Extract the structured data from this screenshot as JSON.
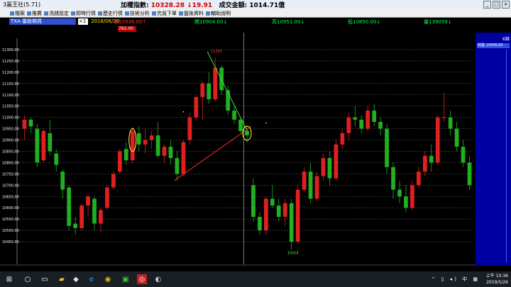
{
  "titlebar": {
    "app_name": "3贏王社(5.71)",
    "index_label": "加權指數: ",
    "index_value": "10328.28",
    "index_change": "↓19.91",
    "turnover_label": "成交金額: ",
    "turnover_value": "1014.71億"
  },
  "menu": {
    "items": [
      "檔案",
      "推薦",
      "洗錢設定",
      "即時行情",
      "歷史行情",
      "技術分析",
      "究竟下單",
      "盤後資料",
      "輔助說明"
    ]
  },
  "info": {
    "symbol": "TXA 臺股期貨",
    "multiplier": "×1",
    "date": "2018/06/20",
    "close": "收10936.00↑",
    "open": "開10904.00↓",
    "high": "高10951.00↓",
    "low": "低10850.00↓",
    "volume": "量139059↓",
    "current_box": "762.00"
  },
  "right_panel": {
    "k_label": "K線",
    "legend": "收盤 10936.00"
  },
  "chart_data": {
    "type": "candlestick",
    "y_ticks": [
      11300,
      11250,
      11200,
      11150,
      11100,
      11050,
      11000,
      10950,
      10900,
      10850,
      10800,
      10750,
      10700,
      10650,
      10600,
      10550,
      10500,
      10450
    ],
    "x_labels": [
      {
        "label": "2018",
        "i": 0
      },
      {
        "label": "4",
        "i": 2
      },
      {
        "label": "5",
        "i": 9
      },
      {
        "label": "6",
        "i": 24
      },
      {
        "label": "7",
        "i": 36
      },
      {
        "label": "8",
        "i": 50
      },
      {
        "label": "9",
        "i": 64
      }
    ],
    "annotation_high": "11263",
    "annotation_low": "10414",
    "candles": [
      [
        10950,
        11010,
        10900,
        10990
      ],
      [
        10990,
        11000,
        10930,
        10960
      ],
      [
        10950,
        10970,
        10780,
        10800
      ],
      [
        10810,
        10950,
        10800,
        10940
      ],
      [
        10930,
        10990,
        10830,
        10850
      ],
      [
        10840,
        10860,
        10760,
        10790
      ],
      [
        10760,
        10770,
        10640,
        10680
      ],
      [
        10690,
        10700,
        10500,
        10520
      ],
      [
        10530,
        10560,
        10480,
        10510
      ],
      [
        10510,
        10620,
        10500,
        10610
      ],
      [
        10610,
        10660,
        10560,
        10650
      ],
      [
        10640,
        10650,
        10500,
        10530
      ],
      [
        10530,
        10600,
        10490,
        10590
      ],
      [
        10600,
        10700,
        10590,
        10690
      ],
      [
        10690,
        10760,
        10680,
        10750
      ],
      [
        10760,
        10860,
        10750,
        10850
      ],
      [
        10860,
        10890,
        10790,
        10810
      ],
      [
        10810,
        10960,
        10800,
        10940
      ],
      [
        10930,
        10960,
        10850,
        10880
      ],
      [
        10880,
        10950,
        10840,
        10900
      ],
      [
        10900,
        10940,
        10860,
        10920
      ],
      [
        10920,
        10980,
        10820,
        10830
      ],
      [
        10830,
        10880,
        10800,
        10870
      ],
      [
        10870,
        10900,
        10790,
        10820
      ],
      [
        10820,
        10850,
        10720,
        10750
      ],
      [
        10750,
        10900,
        10740,
        10890
      ],
      [
        10900,
        11020,
        10880,
        11000
      ],
      [
        11000,
        11100,
        10990,
        11090
      ],
      [
        11090,
        11160,
        10990,
        11150
      ],
      [
        11150,
        11200,
        11060,
        11080
      ],
      [
        11080,
        11263,
        11070,
        11220
      ],
      [
        11220,
        11230,
        11100,
        11120
      ],
      [
        11120,
        11140,
        11010,
        11030
      ],
      [
        11030,
        11050,
        10970,
        10990
      ],
      [
        10990,
        11000,
        10930,
        10940
      ],
      [
        10940,
        10960,
        10890,
        10920
      ],
      [
        10700,
        10730,
        10540,
        10560
      ],
      [
        10560,
        10580,
        10480,
        10500
      ],
      [
        10500,
        10650,
        10480,
        10640
      ],
      [
        10640,
        10700,
        10600,
        10610
      ],
      [
        10610,
        10640,
        10540,
        10560
      ],
      [
        10560,
        10640,
        10520,
        10620
      ],
      [
        10620,
        10640,
        10414,
        10450
      ],
      [
        10450,
        10700,
        10440,
        10680
      ],
      [
        10680,
        10780,
        10670,
        10760
      ],
      [
        10760,
        10800,
        10620,
        10640
      ],
      [
        10640,
        10760,
        10630,
        10740
      ],
      [
        10740,
        10840,
        10720,
        10820
      ],
      [
        10820,
        10850,
        10700,
        10730
      ],
      [
        10730,
        10900,
        10720,
        10880
      ],
      [
        10880,
        10950,
        10860,
        10930
      ],
      [
        10930,
        11020,
        10900,
        11000
      ],
      [
        11000,
        11050,
        10960,
        10990
      ],
      [
        10990,
        11010,
        10930,
        10950
      ],
      [
        10950,
        11050,
        10940,
        11030
      ],
      [
        11030,
        11060,
        10960,
        10980
      ],
      [
        10980,
        11000,
        10920,
        10950
      ],
      [
        10950,
        10970,
        10750,
        10780
      ],
      [
        10780,
        10800,
        10640,
        10680
      ],
      [
        10680,
        10720,
        10620,
        10650
      ],
      [
        10650,
        10700,
        10580,
        10600
      ],
      [
        10600,
        10720,
        10590,
        10700
      ],
      [
        10700,
        10780,
        10690,
        10760
      ],
      [
        10760,
        10850,
        10740,
        10830
      ],
      [
        10830,
        10880,
        10760,
        10800
      ],
      [
        10800,
        11010,
        10790,
        11000
      ],
      [
        11000,
        11110,
        10980,
        11000
      ],
      [
        11000,
        11030,
        10920,
        10950
      ],
      [
        10950,
        10980,
        10850,
        10870
      ],
      [
        10870,
        10900,
        10780,
        10800
      ],
      [
        10800,
        10830,
        10680,
        10700
      ]
    ]
  }
}
